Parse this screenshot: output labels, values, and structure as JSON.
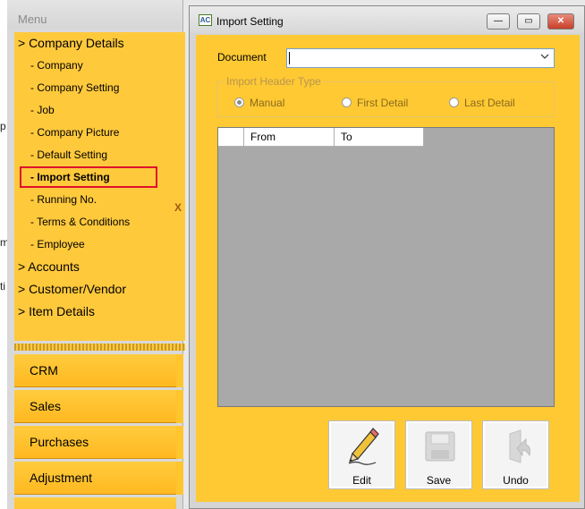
{
  "left_strip": {
    "fragments": [
      "p",
      "m",
      "ti"
    ]
  },
  "menu": {
    "header": "Menu",
    "items": [
      {
        "label": "> Company Details",
        "level": "top"
      },
      {
        "label": "- Company",
        "level": "sub"
      },
      {
        "label": "- Company Setting",
        "level": "sub"
      },
      {
        "label": "- Job",
        "level": "sub"
      },
      {
        "label": "- Company Picture",
        "level": "sub"
      },
      {
        "label": "- Default Setting",
        "level": "sub"
      },
      {
        "label": "- Import Setting",
        "level": "sub",
        "selected": true
      },
      {
        "label": "- Running No.",
        "level": "sub"
      },
      {
        "label": "- Terms & Conditions",
        "level": "sub"
      },
      {
        "label": "- Employee",
        "level": "sub"
      },
      {
        "label": "> Accounts",
        "level": "top"
      },
      {
        "label": "> Customer/Vendor",
        "level": "top"
      },
      {
        "label": "> Item Details",
        "level": "top"
      }
    ],
    "close_mark": "X",
    "modules": [
      "CRM",
      "Sales",
      "Purchases",
      "Adjustment"
    ]
  },
  "window": {
    "title": "Import Setting",
    "icon_text": "AC",
    "controls": {
      "minimize": "—",
      "maximize": "▭",
      "close": "✕"
    },
    "document": {
      "label": "Document",
      "value": ""
    },
    "import_header_type": {
      "legend": "Import Header Type",
      "options": [
        {
          "label": "Manual",
          "checked": true
        },
        {
          "label": "First Detail",
          "checked": false
        },
        {
          "label": "Last Detail",
          "checked": false
        }
      ]
    },
    "grid": {
      "columns": [
        "",
        "From",
        "To"
      ]
    },
    "buttons": [
      {
        "label": "Edit",
        "icon": "pencil-icon",
        "enabled": true
      },
      {
        "label": "Save",
        "icon": "floppy-disk-icon",
        "enabled": false
      },
      {
        "label": "Undo",
        "icon": "undo-arrow-icon",
        "enabled": false
      }
    ]
  },
  "colors": {
    "menu_background": "#ffc93c",
    "content_background": "#ffc933",
    "selection_border": "#e0102c",
    "grid_background": "#a9a9a9"
  }
}
